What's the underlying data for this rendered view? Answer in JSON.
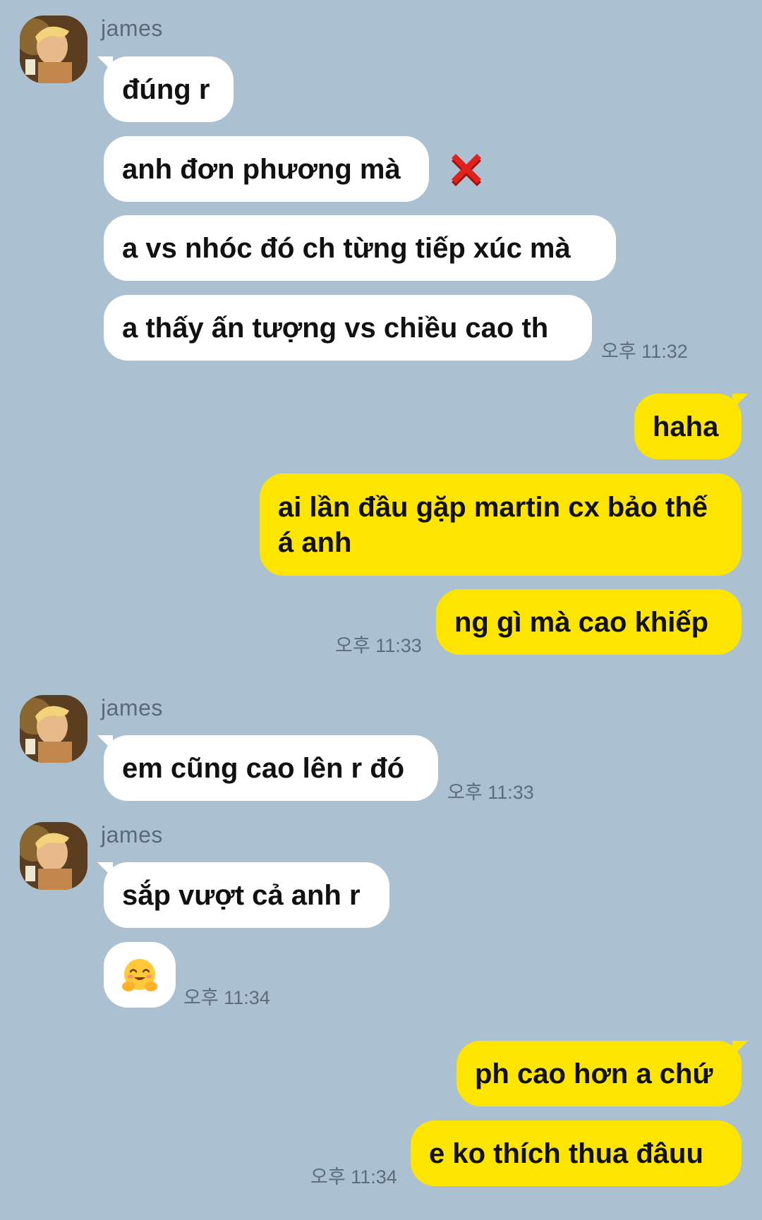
{
  "groups": [
    {
      "sender": "james",
      "messages": [
        "đúng r",
        "anh đơn phương mà",
        "a vs nhóc đó ch từng tiếp xúc mà",
        "a thấy ấn tượng vs chiều cao th"
      ],
      "time": "오후 11:32"
    },
    {
      "messages": [
        "haha",
        "ai lần đầu gặp martin cx bảo thế á anh",
        "ng gì mà cao khiếp"
      ],
      "time": "오후 11:33"
    },
    {
      "sender": "james",
      "messages": [
        "em cũng cao lên r đó"
      ],
      "time": "오후 11:33"
    },
    {
      "sender": "james",
      "messages": [
        "sắp vượt cả anh r"
      ],
      "time": "오후 11:34"
    },
    {
      "messages": [
        "ph cao hơn a chứ",
        "e ko thích thua đâuu"
      ],
      "time": "오후 11:34"
    }
  ],
  "icons": {
    "reaction": "cross-mark-icon",
    "hug": "hugging-face-emoji",
    "avatar": "profile-photo"
  },
  "colors": {
    "background": "#abc1d1",
    "incoming_bubble": "#ffffff",
    "outgoing_bubble": "#fee500",
    "timestamp": "#5d6d7a",
    "sender_name": "#5a6a78"
  }
}
